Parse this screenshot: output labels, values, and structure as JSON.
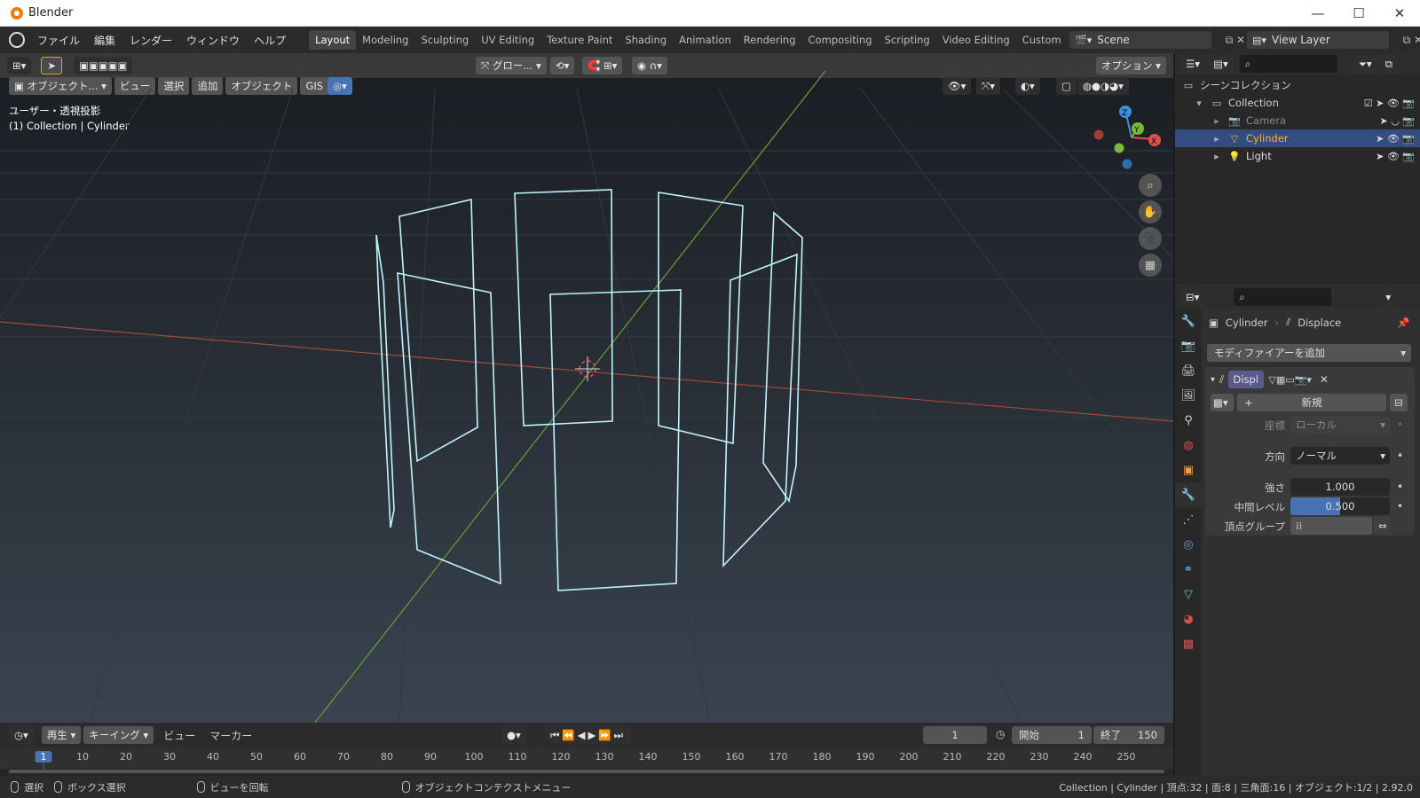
{
  "window": {
    "title": "Blender",
    "min": "—",
    "max": "☐",
    "close": "✕"
  },
  "menu": [
    "ファイル",
    "編集",
    "レンダー",
    "ウィンドウ",
    "ヘルプ"
  ],
  "workspace_tabs": [
    "Layout",
    "Modeling",
    "Sculpting",
    "UV Editing",
    "Texture Paint",
    "Shading",
    "Animation",
    "Rendering",
    "Compositing",
    "Scripting",
    "Video Editing",
    "Custom"
  ],
  "active_tab": "Layout",
  "scene": {
    "name": "Scene",
    "view_layer": "View Layer"
  },
  "toolbar": {
    "transform_orientation": "グロー...",
    "options": "オプション"
  },
  "viewport_header": {
    "mode": "オブジェクト...",
    "view": "ビュー",
    "select": "選択",
    "add": "追加",
    "object": "オブジェクト",
    "gis": "GIS"
  },
  "viewport_overlay": {
    "view_name": "ユーザー・透視投影",
    "context": "(1) Collection | Cylinder"
  },
  "gizmo": {
    "x": "X",
    "y": "Y",
    "z": "Z"
  },
  "outliner": {
    "root": "シーンコレクション",
    "collection": "Collection",
    "items": [
      {
        "name": "Camera",
        "selected": false
      },
      {
        "name": "Cylinder",
        "selected": true
      },
      {
        "name": "Light",
        "selected": false
      }
    ]
  },
  "properties": {
    "breadcrumb_object": "Cylinder",
    "breadcrumb_modifier": "Displace",
    "add_modifier": "モディファイアーを追加",
    "modifier_name": "Displ",
    "new_texture": "新規",
    "coords_label": "座標",
    "coords_value": "ローカル",
    "direction_label": "方向",
    "direction_value": "ノーマル",
    "strength_label": "強さ",
    "strength_value": "1.000",
    "midlevel_label": "中間レベル",
    "midlevel_value": "0.500",
    "midlevel_fraction": 0.5,
    "vgroup_label": "頂点グループ"
  },
  "timeline": {
    "playback": "再生",
    "keying": "キーイング",
    "view": "ビュー",
    "marker": "マーカー",
    "current_frame": "1",
    "start_label": "開始",
    "start_value": "1",
    "end_label": "終了",
    "end_value": "150",
    "ruler": [
      "1",
      "10",
      "20",
      "30",
      "40",
      "50",
      "60",
      "70",
      "80",
      "90",
      "100",
      "110",
      "120",
      "130",
      "140",
      "150",
      "160",
      "170",
      "180",
      "190",
      "200",
      "210",
      "220",
      "230",
      "240",
      "250"
    ]
  },
  "status": {
    "select": "選択",
    "box_select": "ボックス選択",
    "rotate_view": "ビューを回転",
    "context_menu": "オブジェクトコンテクストメニュー",
    "stats": "Collection | Cylinder | 頂点:32 | 面:8 | 三角面:16 | オブジェクト:1/2 | 2.92.0"
  }
}
